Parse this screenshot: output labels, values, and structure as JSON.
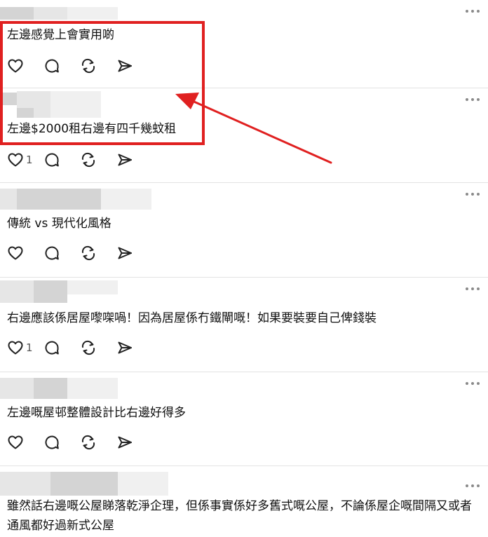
{
  "accent_color": "#e02020",
  "icons": [
    "heart-icon",
    "comment-icon",
    "repost-icon",
    "share-icon",
    "more-icon"
  ],
  "posts": [
    {
      "text": "左邊感覺上會實用啲",
      "likes": ""
    },
    {
      "text": "左邊$2000租右邊有四千幾蚊租",
      "likes": "1"
    },
    {
      "text": "傳統 vs 現代化風格",
      "likes": ""
    },
    {
      "text": "右邊應該係居屋嚟㗎喎！因為居屋係冇鐵閘嘅！如果要裝要自己俾錢裝",
      "likes": "1"
    },
    {
      "text": "左邊嘅屋邨整體設計比右邊好得多",
      "likes": ""
    },
    {
      "text": "雖然話右邊嘅公屋睇落乾淨企理，但係事實係好多舊式嘅公屋，不論係屋企嘅間隔又或者通風都好過新式公屋",
      "likes": ""
    }
  ]
}
